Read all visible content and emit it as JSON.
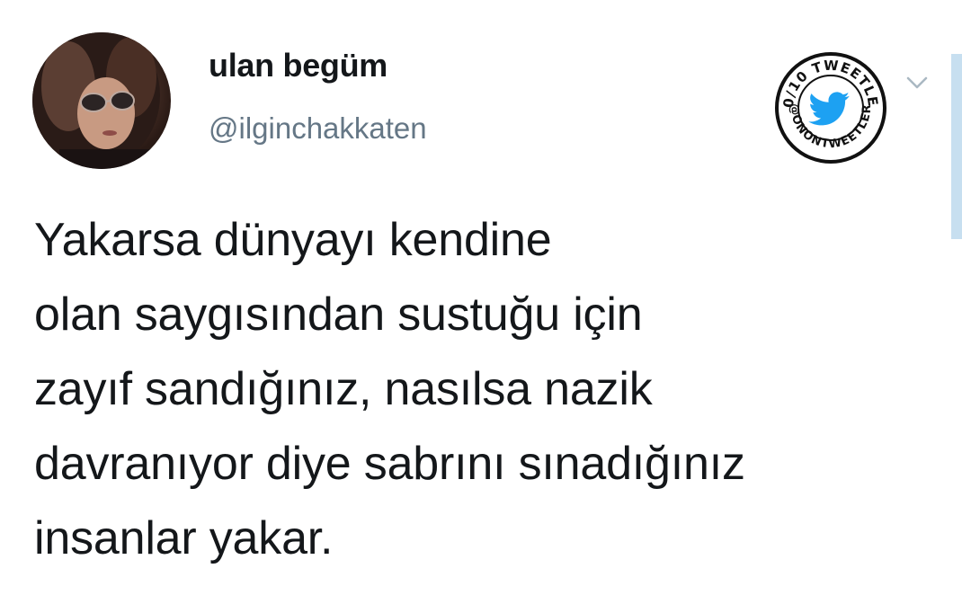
{
  "user": {
    "display_name": "ulan begüm",
    "handle": "@ilginchakkaten"
  },
  "tweet": {
    "lines": [
      "Yakarsa dünyayı kendine",
      "olan saygısından sustuğu için",
      "zayıf sandığınız, nasılsa nazik",
      "davranıyor diye sabrını sınadığınız",
      "insanlar yakar."
    ]
  },
  "badge": {
    "top_text": "10/10 TWEETLER",
    "bottom_text": "@ONONTWEETLER",
    "icon": "twitter-bird-icon"
  },
  "icons": {
    "menu": "chevron-down-icon",
    "avatar": "avatar"
  },
  "colors": {
    "text": "#14171a",
    "handle": "#657786",
    "twitter_blue": "#1da1f2",
    "scrollbar": "#c7dff0"
  }
}
